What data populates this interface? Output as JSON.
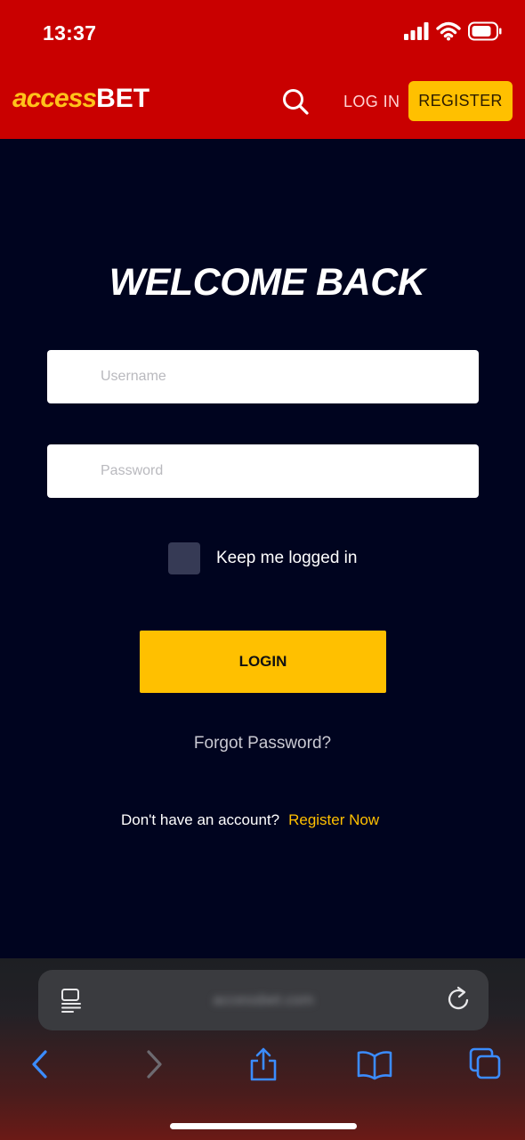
{
  "status": {
    "time": "13:37"
  },
  "header": {
    "logo_access": "access",
    "logo_bet": "BET",
    "login_label": "LOG IN",
    "register_label": "REGISTER"
  },
  "main": {
    "title": "WELCOME BACK",
    "username_placeholder": "Username",
    "password_placeholder": "Password",
    "keep_logged_in": "Keep me logged in",
    "login_button": "LOGIN",
    "forgot_password": "Forgot Password?",
    "no_account": "Don't have an account?",
    "register_now": "Register Now"
  },
  "browser": {
    "url": "accessbet.com"
  },
  "colors": {
    "brand_red": "#c90000",
    "accent_yellow": "#ffc000",
    "background_navy": "#00041f"
  },
  "icons": [
    "search-icon",
    "reader-icon",
    "reload-icon",
    "back-icon",
    "forward-icon",
    "share-icon",
    "bookmarks-icon",
    "tabs-icon",
    "signal-icon",
    "wifi-icon",
    "battery-icon"
  ]
}
